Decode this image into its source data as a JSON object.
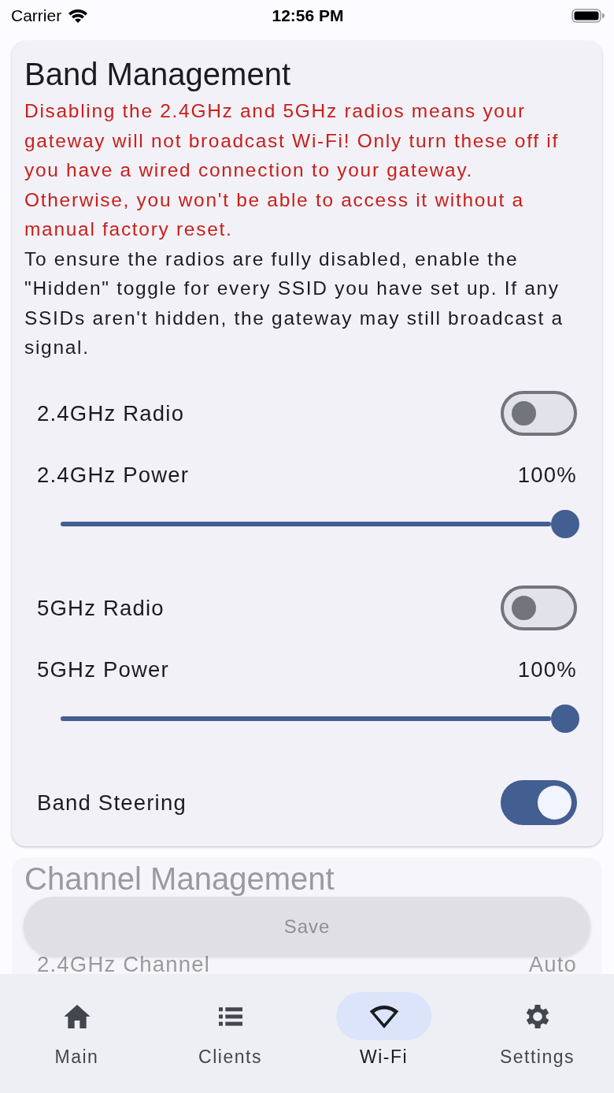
{
  "status_bar": {
    "carrier": "Carrier",
    "time": "12:56 PM"
  },
  "band_card": {
    "title": "Band Management",
    "warning": "Disabling the 2.4GHz and 5GHz radios means your gateway will not broadcast Wi-Fi! Only turn these off if you have a wired connection to your gateway. Otherwise, you won't be able to access it without a manual factory reset.",
    "note": "To ensure the radios are fully disabled, enable the \"Hidden\" toggle for every SSID you have set up. If any SSIDs aren't hidden, the gateway may still broadcast a signal.",
    "settings": [
      {
        "kind": "toggle",
        "label": "2.4GHz Radio",
        "on": false
      },
      {
        "kind": "slider",
        "label": "2.4GHz Power",
        "reading": "100%",
        "level": 1.0
      },
      {
        "kind": "toggle",
        "label": "5GHz Radio",
        "on": false
      },
      {
        "kind": "slider",
        "label": "5GHz Power",
        "reading": "100%",
        "level": 1.0
      },
      {
        "kind": "toggle",
        "label": "Band Steering",
        "on": true
      }
    ]
  },
  "channel_card": {
    "title": "Channel Management",
    "rows": [
      {
        "label": "2.4GHz Channel",
        "value": "Auto"
      }
    ]
  },
  "save_button": {
    "label": "Save",
    "disabled": true
  },
  "nav": [
    {
      "label": "Main",
      "selected": false
    },
    {
      "label": "Clients",
      "selected": false
    },
    {
      "label": "Wi-Fi",
      "selected": true
    },
    {
      "label": "Settings",
      "selected": false
    }
  ]
}
